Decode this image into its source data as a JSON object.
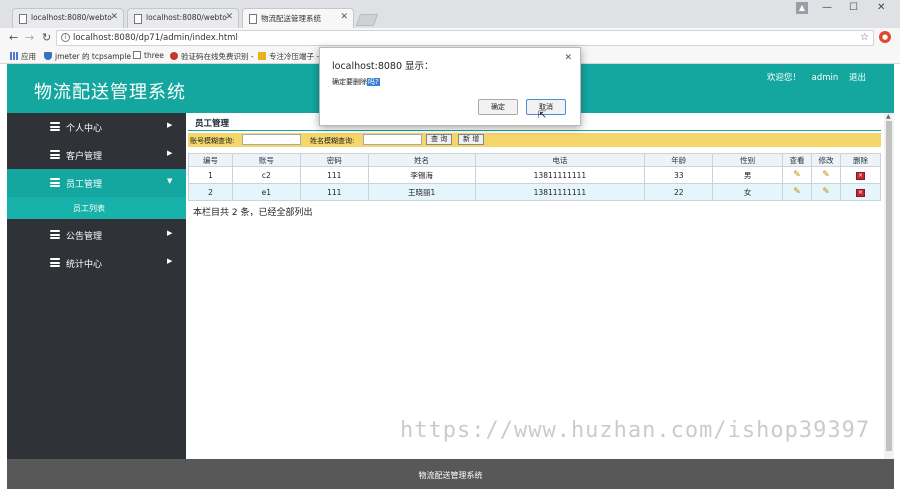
{
  "browser": {
    "tabs": [
      {
        "label": "localhost:8080/webto"
      },
      {
        "label": "localhost:8080/webto"
      },
      {
        "label": "物流配送管理系统"
      }
    ],
    "url": "localhost:8080/dp71/admin/index.html",
    "bookmarks": [
      "应用",
      "jmeter 的 tcpsample",
      "three",
      "验证码在线免费识别 -",
      "专注冷压端子 -"
    ]
  },
  "header": {
    "title": "物流配送管理系统",
    "welcome": "欢迎您！",
    "username": "admin",
    "logout": "退出"
  },
  "sidebar": {
    "items": [
      {
        "label": "个人中心"
      },
      {
        "label": "客户管理"
      },
      {
        "label": "员工管理"
      },
      {
        "label": "公告管理"
      },
      {
        "label": "统计中心"
      }
    ],
    "submenu": "员工列表"
  },
  "content": {
    "title": "员工管理",
    "search_account_label": "账号模糊查询:",
    "search_name_label": "姓名模糊查询:",
    "query_button": "查 询",
    "add_button": "新 增",
    "columns": [
      "编号",
      "账号",
      "密码",
      "姓名",
      "电话",
      "年龄",
      "性别",
      "查看",
      "修改",
      "删除"
    ],
    "rows": [
      {
        "id": "1",
        "account": "c2",
        "password": "111",
        "name": "李锡海",
        "phone": "13811111111",
        "age": "33",
        "gender": "男"
      },
      {
        "id": "2",
        "account": "e1",
        "password": "111",
        "name": "王晓丽1",
        "phone": "13811111111",
        "age": "22",
        "gender": "女"
      }
    ],
    "summary": "本栏目共 2 条，已经全部列出"
  },
  "footer": {
    "text": "物流配送管理系统"
  },
  "dialog": {
    "title": "localhost:8080 显示：",
    "message": "确定要删除",
    "message_highlight": "吗?",
    "ok": "确定",
    "cancel": "取消"
  },
  "watermark": "https://www.huzhan.com/ishop39397"
}
